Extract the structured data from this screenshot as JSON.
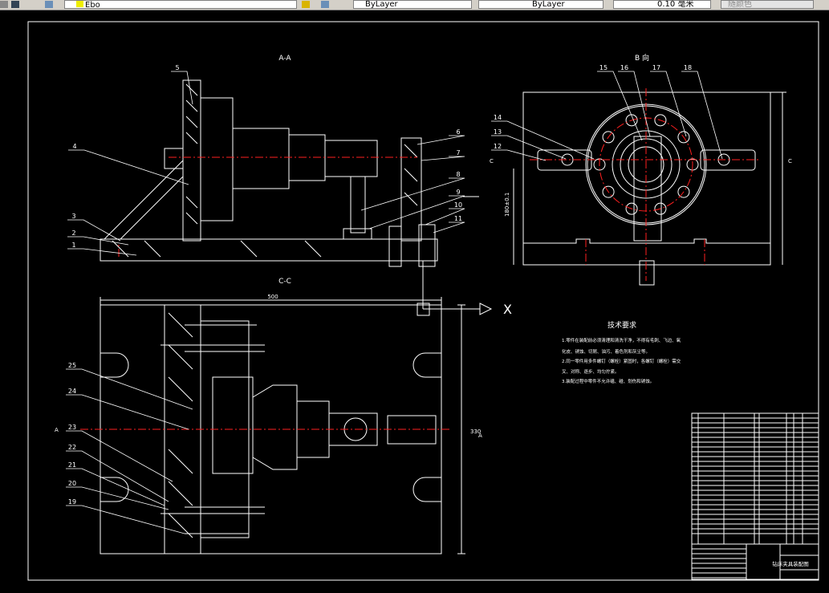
{
  "toolbar": {
    "layer_name": "Ebo",
    "color": "ByLayer",
    "linetype": "ByLayer",
    "lineweight": "0.10 毫米",
    "plotstyle": "随颜色",
    "icons": [
      "layer-manager-icon",
      "bulb-icon",
      "sun-icon",
      "lock-icon",
      "match-layer-icon",
      "layer-previous-icon"
    ]
  },
  "drawing": {
    "section_aa": "A-A",
    "view_b": "B 向",
    "section_cc": "C-C",
    "tech_title": "技术要求",
    "tech_lines": [
      "1.零件在装配前必须清理和清洗干净，不得有毛刺、飞边、氧",
      "化皮、锈蚀、切屑、油污、着色剂和灰尘等。",
      "2.同一零件用多件螺钉（螺栓）紧固时，各螺钉（螺栓）需交",
      "叉、对称、逐步、均匀拧紧。",
      "3.装配过程中零件不允许磕、碰、划伤和锈蚀。"
    ],
    "dim_500": "500",
    "dim_side": "330",
    "dim_b": "180±0.1",
    "marker_x": "X",
    "cut_c_left": "C",
    "cut_c_right": "C",
    "cut_a_left": "A",
    "cut_a_right": "A",
    "part_labels": [
      "1",
      "2",
      "3",
      "4",
      "5",
      "6",
      "7",
      "8",
      "9",
      "10",
      "11",
      "12",
      "13",
      "14",
      "15",
      "16",
      "17",
      "18",
      "19",
      "20",
      "21",
      "22",
      "23",
      "24",
      "25"
    ],
    "title_block_name": "钻床夹具装配图"
  },
  "colors": {
    "background": "#000000",
    "lines": "#ffffff",
    "centerlines": "#ff2020",
    "toolbar": "#d4d0c8"
  }
}
